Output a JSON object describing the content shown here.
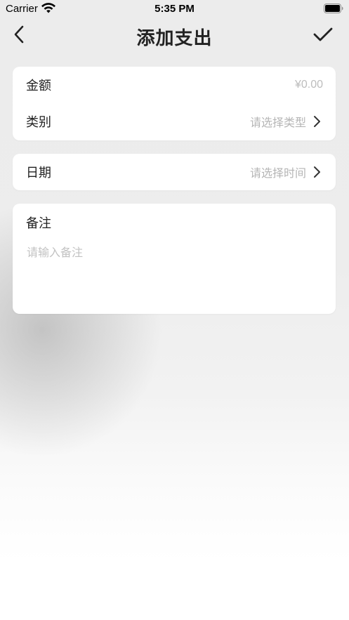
{
  "status_bar": {
    "carrier": "Carrier",
    "time": "5:35 PM",
    "wifi_icon": "wifi-icon",
    "battery_icon": "battery-icon"
  },
  "nav": {
    "title": "添加支出",
    "back_icon": "chevron-left-icon",
    "done_icon": "checkmark-icon"
  },
  "form": {
    "amount": {
      "label": "金额",
      "value": "",
      "placeholder": "¥0.00"
    },
    "category": {
      "label": "类别",
      "placeholder": "请选择类型",
      "icon": "chevron-right-icon"
    },
    "date": {
      "label": "日期",
      "placeholder": "请选择时间",
      "icon": "chevron-right-icon"
    },
    "note": {
      "label": "备注",
      "value": "",
      "placeholder": "请输入备注"
    }
  },
  "colors": {
    "text_primary": "#222222",
    "placeholder": "#b5b5b5",
    "card_bg": "#ffffff",
    "page_bg": "#ececec"
  }
}
